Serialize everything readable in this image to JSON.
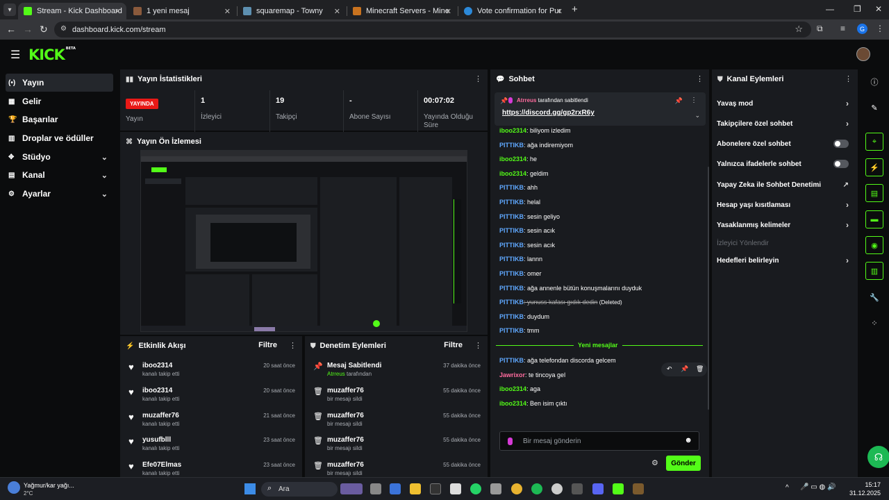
{
  "browser": {
    "tabs": [
      {
        "label": "Stream - Kick Dashboard",
        "active": true,
        "color": "#53fc18"
      },
      {
        "label": "1 yeni mesaj",
        "color": "#8a5a3c"
      },
      {
        "label": "squaremap - Towny",
        "color": "#5d8fb0"
      },
      {
        "label": "Minecraft Servers - Minecraft Se",
        "color": "#c9731f"
      },
      {
        "label": "Vote confirmation for PumkinC",
        "color": "#2c89d9"
      }
    ],
    "url": "dashboard.kick.com/stream",
    "profile_initial": "G"
  },
  "logo": {
    "text": "KICK",
    "badge": "BETA"
  },
  "sidebar": {
    "items": [
      {
        "label": "Yayın",
        "icon": "broadcast-icon",
        "glyph": "(•)",
        "active": true
      },
      {
        "label": "Gelir",
        "icon": "revenue-icon",
        "glyph": "▦"
      },
      {
        "label": "Başarılar",
        "icon": "trophy-icon",
        "glyph": "🏆"
      },
      {
        "label": "Droplar ve ödüller",
        "icon": "gift-icon",
        "glyph": "▥"
      },
      {
        "label": "Stüdyo",
        "icon": "studio-icon",
        "glyph": "✥",
        "chevron": true
      },
      {
        "label": "Kanal",
        "icon": "channel-icon",
        "glyph": "▤",
        "chevron": true
      },
      {
        "label": "Ayarlar",
        "icon": "gear-icon",
        "glyph": "⚙",
        "chevron": true
      }
    ]
  },
  "stats": {
    "title": "Yayın İstatistikleri",
    "live_badge": "YAYINDA",
    "items": [
      {
        "value": "",
        "label": "Yayın"
      },
      {
        "value": "1",
        "label": "İzleyici"
      },
      {
        "value": "19",
        "label": "Takipçi"
      },
      {
        "value": "-",
        "label": "Abone Sayısı"
      },
      {
        "value": "00:07:02",
        "label": "Yayında Olduğu Süre"
      }
    ]
  },
  "preview": {
    "title": "Yayın Ön İzlemesi"
  },
  "activity": {
    "title": "Etkinlik Akışı",
    "filter": "Filtre",
    "rows": [
      {
        "name": "iboo2314",
        "sub": "kanalı takip etti",
        "time": "20 saat önce"
      },
      {
        "name": "iboo2314",
        "sub": "kanalı takip etti",
        "time": "20 saat önce"
      },
      {
        "name": "muzaffer76",
        "sub": "kanalı takip etti",
        "time": "21 saat önce"
      },
      {
        "name": "yusufblll",
        "sub": "kanalı takip etti",
        "time": "23 saat önce"
      },
      {
        "name": "Efe07Elmas",
        "sub": "kanalı takip etti",
        "time": "23 saat önce"
      }
    ]
  },
  "moderation": {
    "title": "Denetim Eylemleri",
    "filter": "Filtre",
    "rows": [
      {
        "name": "Mesaj Sabitlendi",
        "sub": "Atrreus",
        "sub2": " tarafından",
        "time": "37 dakika önce",
        "icon": "pin-icon",
        "glyph": "📌"
      },
      {
        "name": "muzaffer76",
        "sub": "bir mesajı sildi",
        "time": "55 dakika önce",
        "icon": "trash-icon",
        "glyph": "🗑"
      },
      {
        "name": "muzaffer76",
        "sub": "bir mesajı sildi",
        "time": "55 dakika önce",
        "icon": "trash-icon",
        "glyph": "🗑"
      },
      {
        "name": "muzaffer76",
        "sub": "bir mesajı sildi",
        "time": "55 dakika önce",
        "icon": "trash-icon",
        "glyph": "🗑"
      },
      {
        "name": "muzaffer76",
        "sub": "bir mesajı sildi",
        "time": "55 dakika önce",
        "icon": "trash-icon",
        "glyph": "🗑"
      }
    ]
  },
  "chat": {
    "title": "Sohbet",
    "pinned": {
      "user": "Atrreus",
      "by": " tarafından sabitlendi",
      "link": "https://discord.gg/gp2rxR6y"
    },
    "messages": [
      {
        "user": "iboo2314",
        "text": ": biliyom izledim",
        "color": "cg"
      },
      {
        "user": "PITTIKB",
        "text": ": ağa indiremiyom",
        "color": "cb"
      },
      {
        "user": "iboo2314",
        "text": ": he",
        "color": "cg"
      },
      {
        "user": "iboo2314",
        "text": ": geldim",
        "color": "cg"
      },
      {
        "user": "PITTIKB",
        "text": ": ahh",
        "color": "cb"
      },
      {
        "user": "PITTIKB",
        "text": ": helal",
        "color": "cb"
      },
      {
        "user": "PITTIKB",
        "text": ": sesin geliyo",
        "color": "cb"
      },
      {
        "user": "PITTIKB",
        "text": ": sesin acık",
        "color": "cb"
      },
      {
        "user": "PITTIKB",
        "text": ": sesin acık",
        "color": "cb"
      },
      {
        "user": "PITTIKB",
        "text": ": lannn",
        "color": "cb"
      },
      {
        "user": "PITTIKB",
        "text": ": omer",
        "color": "cb"
      },
      {
        "user": "PITTIKB",
        "text": ": ağa annenle bütün konuşmalarını duyduk",
        "color": "cb"
      },
      {
        "user": "PITTIKB",
        "text": ": yunuss kafası gıdık dedin",
        "color": "cb",
        "deleted": " (Deleted)"
      },
      {
        "user": "PITTIKB",
        "text": ": duydum",
        "color": "cb"
      },
      {
        "user": "PITTIKB",
        "text": ": tmm",
        "color": "cb"
      }
    ],
    "new_label": "Yeni mesajlar",
    "new_messages": [
      {
        "user": "PITTIKB",
        "text": ": ağa telefondan discorda gelcem",
        "color": "cb"
      },
      {
        "user": "Jawrixor",
        "text": ": te tincoya gel",
        "color": "cp"
      },
      {
        "user": "iboo2314",
        "text": ": aga",
        "color": "cg"
      },
      {
        "user": "iboo2314",
        "text": ": Ben isim çıktı",
        "color": "cg"
      }
    ],
    "input_placeholder": "Bir mesaj gönderin",
    "send": "Gönder"
  },
  "channel_actions": {
    "title": "Kanal Eylemleri",
    "items": [
      {
        "label": "Yavaş mod",
        "type": "arrow"
      },
      {
        "label": "Takipçilere özel sohbet",
        "type": "arrow"
      },
      {
        "label": "Abonelere özel sohbet",
        "type": "toggle"
      },
      {
        "label": "Yalnızca ifadelerle sohbet",
        "type": "toggle"
      },
      {
        "label": "Yapay Zeka ile Sohbet Denetimi",
        "type": "ext"
      },
      {
        "label": "Hesap yaşı kısıtlaması",
        "type": "arrow"
      },
      {
        "label": "Yasaklanmış kelimeler",
        "type": "arrow"
      },
      {
        "label": "İzleyici Yönlendir",
        "type": "disabled"
      },
      {
        "label": "Hedefleri belirleyin",
        "type": "arrow"
      }
    ]
  },
  "taskbar": {
    "weather": "Yağmur/kar yağı...",
    "temp": "2°C",
    "search": "Ara",
    "time": "15:17",
    "date": "31.12.2025"
  }
}
